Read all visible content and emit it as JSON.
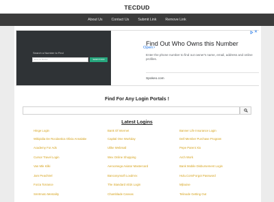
{
  "site": {
    "title": "TECDUD"
  },
  "nav": {
    "items": [
      {
        "label": "About Us"
      },
      {
        "label": "Contact Us"
      },
      {
        "label": "Submit Link"
      },
      {
        "label": "Remove Link"
      }
    ]
  },
  "ad": {
    "left_title": "Search a Number to Find",
    "left_input_placeholder": "Enter the Number",
    "left_button": "SEARCH NOW",
    "headline": "Find Out Who Owns this Number",
    "description": "Enter the phone number to find out owner's name, email, address and online profiles.",
    "domain": "Spokeo.com",
    "cta": "Open",
    "close_glyph": "✕",
    "cta_chevron": "›"
  },
  "search": {
    "heading": "Find For Any Login Portals !",
    "placeholder": ""
  },
  "latest": {
    "heading": "Latest Logins",
    "rows": [
      [
        "Hinge Login",
        "Bank Of Internet",
        "Banner Life Insurance Login"
      ],
      [
        "Wikipidia De Rocdantica Olivia Annalake",
        "Capital One Workday",
        "Dell Member Purchase Program"
      ],
      [
        "Academy For Ads",
        "Ulike Webmail",
        "Pepe Parent Xio"
      ],
      [
        "Cursor Travel Login",
        "Wex Online Shopping",
        "Arch Work"
      ],
      [
        "Van Mle Kilki",
        "Aeroomega Aviator Mastercard",
        "Bank Mobile Disbursement Login"
      ],
      [
        "Jam Peachtrel",
        "Bancosynsoft Loxdmrx",
        "Hulu.Com/Forgot Password"
      ],
      [
        "Forza Torrance",
        "The Standard 401k Login",
        "Mjlouise"
      ],
      [
        "Smrtmoto Mentality",
        "Chamblade Canvas",
        "Telinode Getting Out"
      ]
    ]
  }
}
